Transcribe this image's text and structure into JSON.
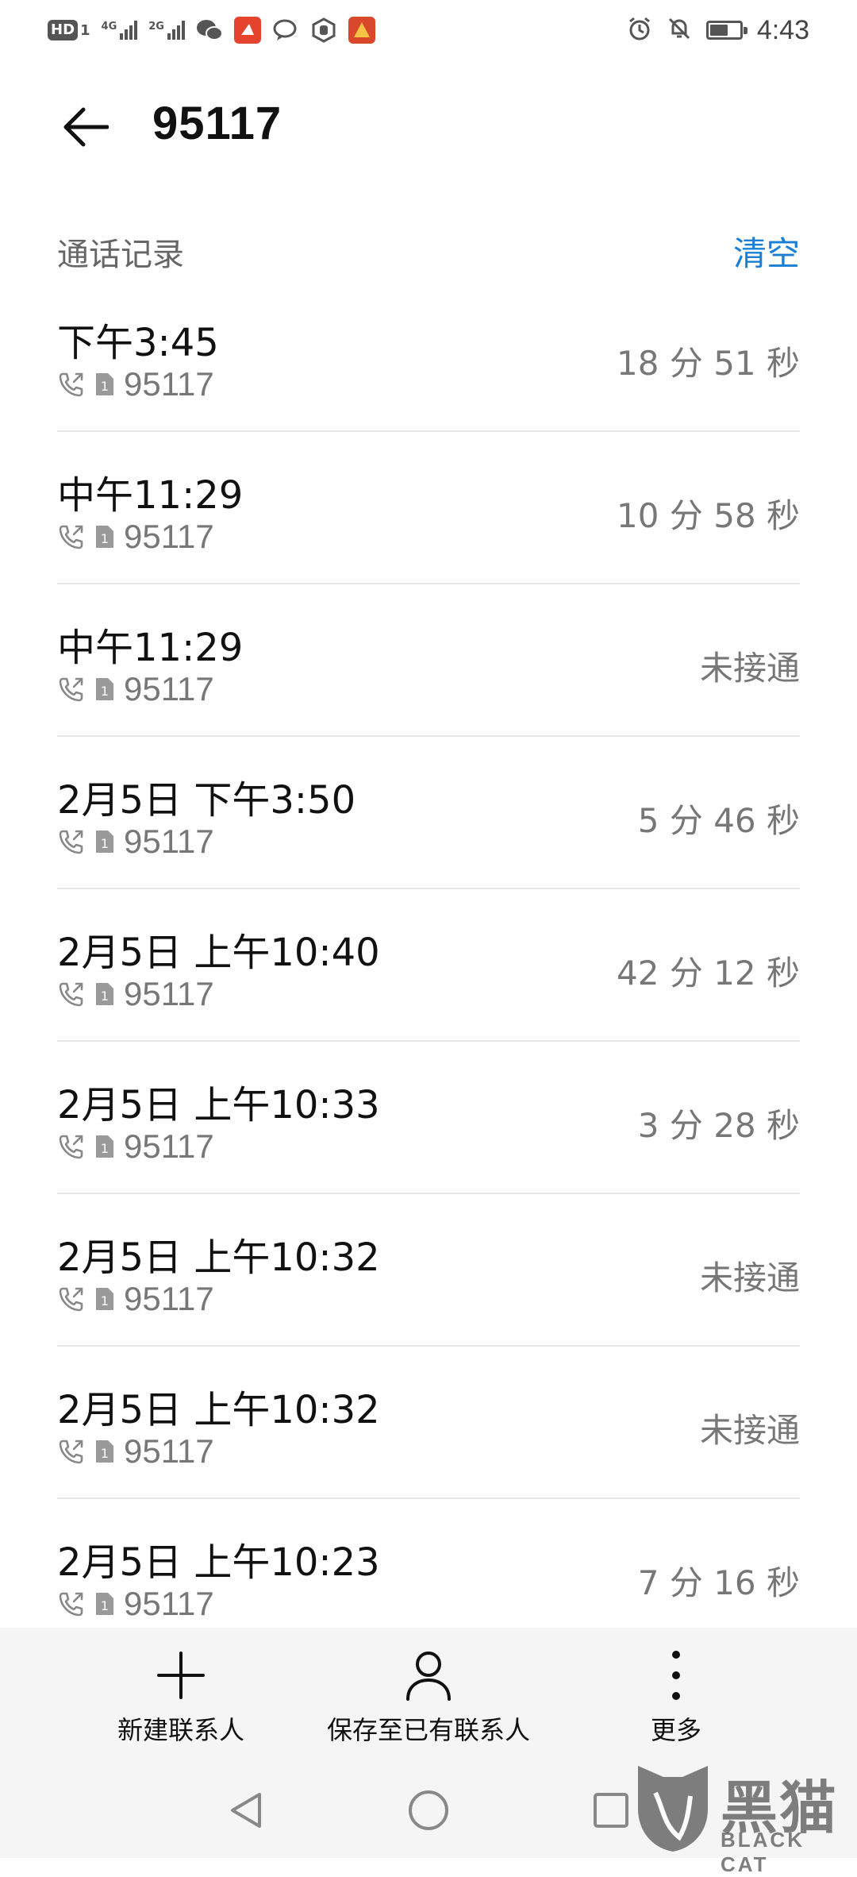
{
  "status_bar": {
    "hd_label": "HD",
    "hd_sim": "1",
    "sim1_network": "4G",
    "sim2_network": "2G",
    "time": "4:43",
    "battery_level": 0.6,
    "icons": [
      "wechat-icon",
      "app-icon-red",
      "chat-icon",
      "hand-icon",
      "app-icon-orange",
      "alarm-icon",
      "mute-bell-icon",
      "battery-icon"
    ]
  },
  "header": {
    "title": "95117"
  },
  "section": {
    "label": "通话记录",
    "clear_label": "清空"
  },
  "calls": [
    {
      "time": "下午3:45",
      "number": "95117",
      "sim": "1",
      "duration": "18 分 51 秒"
    },
    {
      "time": "中午11:29",
      "number": "95117",
      "sim": "1",
      "duration": "10 分 58 秒"
    },
    {
      "time": "中午11:29",
      "number": "95117",
      "sim": "1",
      "duration": "未接通"
    },
    {
      "time": "2月5日 下午3:50",
      "number": "95117",
      "sim": "1",
      "duration": "5 分 46 秒"
    },
    {
      "time": "2月5日 上午10:40",
      "number": "95117",
      "sim": "1",
      "duration": "42 分 12 秒"
    },
    {
      "time": "2月5日 上午10:33",
      "number": "95117",
      "sim": "1",
      "duration": "3 分 28 秒"
    },
    {
      "time": "2月5日 上午10:32",
      "number": "95117",
      "sim": "1",
      "duration": "未接通"
    },
    {
      "time": "2月5日 上午10:32",
      "number": "95117",
      "sim": "1",
      "duration": "未接通"
    },
    {
      "time": "2月5日 上午10:23",
      "number": "95117",
      "sim": "1",
      "duration": "7 分 16 秒"
    }
  ],
  "actions": {
    "new_contact": "新建联系人",
    "save_existing": "保存至已有联系人",
    "more": "更多"
  },
  "watermark": {
    "text": "黑猫",
    "sub": "BLACK CAT"
  },
  "colors": {
    "accent": "#1a7fd4",
    "secondary_text": "#777777",
    "divider": "#e7e7e7"
  }
}
